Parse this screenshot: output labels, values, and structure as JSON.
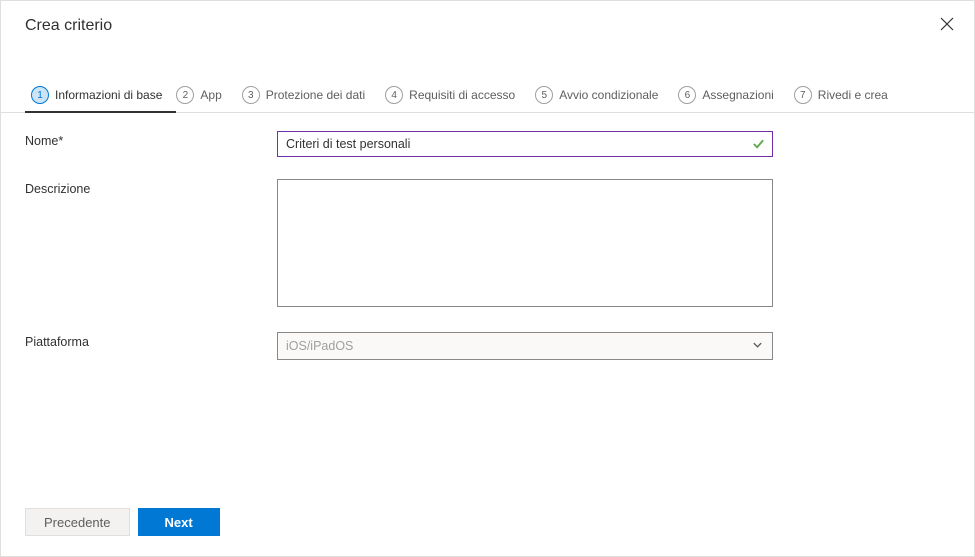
{
  "header": {
    "title": "Crea criterio"
  },
  "tabs": [
    {
      "num": "1",
      "label": "Informazioni di base",
      "active": true
    },
    {
      "num": "2",
      "label": "App"
    },
    {
      "num": "3",
      "label": "Protezione dei dati"
    },
    {
      "num": "4",
      "label": "Requisiti di accesso"
    },
    {
      "num": "5",
      "label": "Avvio condizionale"
    },
    {
      "num": "6",
      "label": "Assegnazioni"
    },
    {
      "num": "7",
      "label": "Rivedi e crea"
    }
  ],
  "form": {
    "name_label": "Nome*",
    "name_value": "Criteri di test personali",
    "desc_label": "Descrizione",
    "desc_value": "",
    "platform_label": "Piattaforma",
    "platform_value": "iOS/iPadOS"
  },
  "footer": {
    "prev_label": "Precedente",
    "next_label": "Next"
  }
}
